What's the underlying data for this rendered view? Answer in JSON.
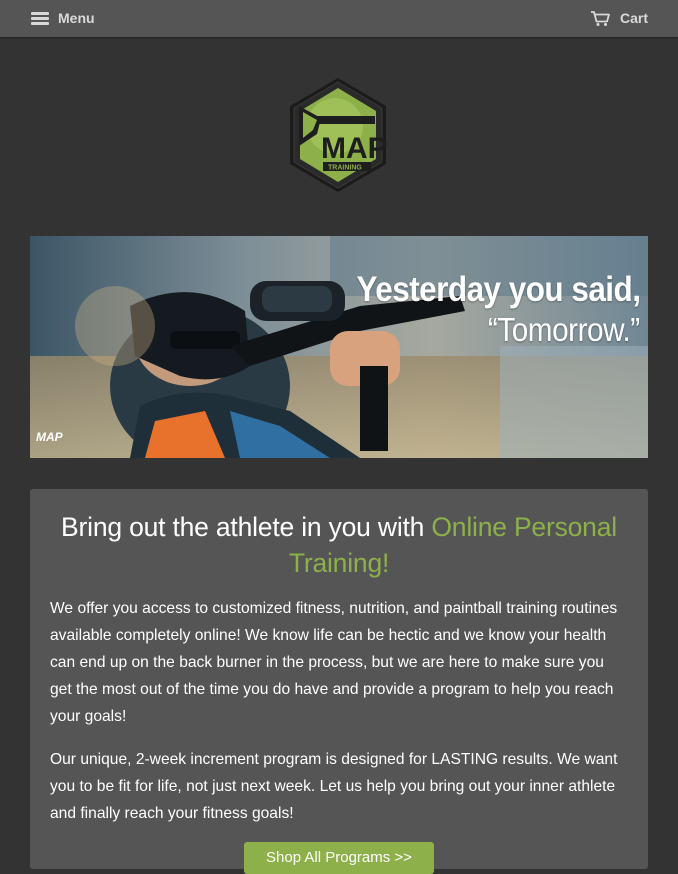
{
  "header": {
    "menu_label": "Menu",
    "cart_label": "Cart",
    "menu_icon": "hamburger-icon",
    "cart_icon": "cart-icon"
  },
  "logo": {
    "text": "MAP",
    "subtext": "TRAINING"
  },
  "hero": {
    "line1": "Yesterday you said,",
    "line2": "“Tomorrow.”",
    "watermark": "MAP"
  },
  "intro": {
    "heading_plain": "Bring out the athlete in you with ",
    "heading_accent": "Online Personal Training!",
    "paragraph1": "We offer you access to customized fitness, nutrition, and paintball training routines available completely online! We know life can be hectic and we know your health can end up on the back burner in the process, but we are here to make sure you get the most out of the time you do have and provide a program to help you reach your goals!",
    "paragraph2": "Our unique, 2-week increment program is designed for LASTING results. We want you to be fit for life, not just next week. Let us help you bring out your inner athlete and finally reach your fitness goals!",
    "cta_label": "Shop All Programs >>"
  },
  "colors": {
    "background": "#333333",
    "header_bar": "#555555",
    "card": "#555555",
    "accent_green": "#8db04a"
  }
}
